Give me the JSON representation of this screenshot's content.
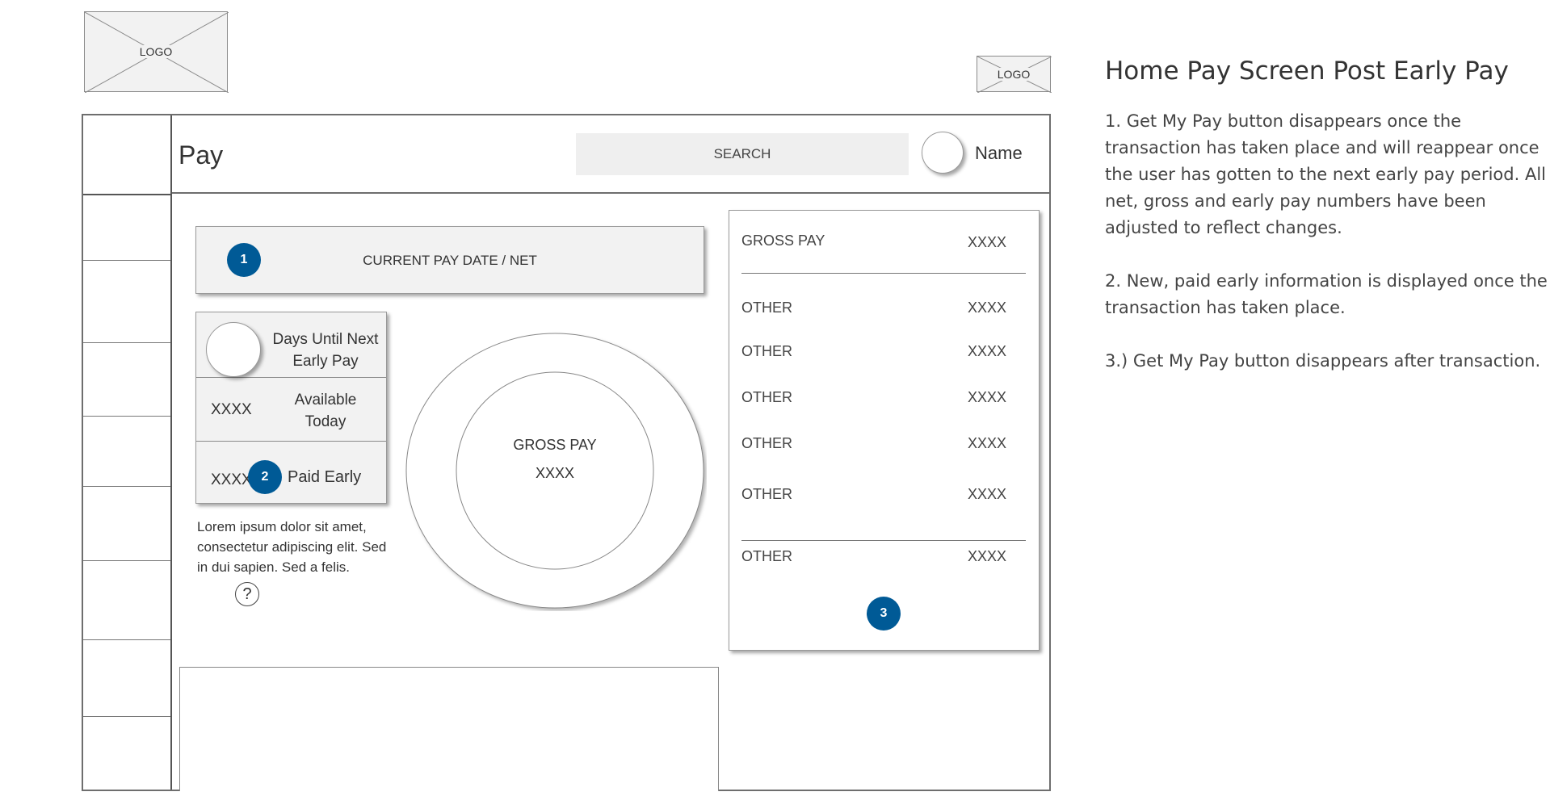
{
  "header_logo_left": "LOGO",
  "header_logo_right": "LOGO",
  "app": {
    "title": "Pay",
    "search_label": "SEARCH",
    "user_name": "Name"
  },
  "sidebar": {
    "item_count": 8
  },
  "current_pay": {
    "badge": "1",
    "label": "CURRENT PAY DATE / NET"
  },
  "early_pay": {
    "days_until_label": "Days Until Next Early Pay",
    "available_value": "XXXX",
    "available_label": "Available Today",
    "paid_value": "XXXX",
    "paid_badge": "2",
    "paid_label": "Paid Early",
    "lorem": "Lorem ipsum dolor sit amet, consectetur adipiscing elit. Sed in dui sapien. Sed a felis.",
    "help_icon": "?"
  },
  "donut": {
    "label": "GROSS PAY",
    "value": "XXXX"
  },
  "breakdown": {
    "gross_label": "GROSS PAY",
    "gross_value": "XXXX",
    "rows": [
      {
        "label": "OTHER",
        "value": "XXXX"
      },
      {
        "label": "OTHER",
        "value": "XXXX"
      },
      {
        "label": "OTHER",
        "value": "XXXX"
      },
      {
        "label": "OTHER",
        "value": "XXXX"
      },
      {
        "label": "OTHER",
        "value": "XXXX"
      }
    ],
    "total_label": "OTHER",
    "total_value": "XXXX",
    "badge": "3"
  },
  "notes": {
    "title": "Home Pay Screen Post Early Pay",
    "items": [
      "1. Get My Pay button disappears once the transaction has taken place and will reappear once the user has gotten to the next early pay period. All net, gross and early pay numbers have been adjusted to reflect changes.",
      "2. New, paid early information is displayed once the transaction has taken place.",
      "3.) Get My Pay button disappears after transaction."
    ]
  },
  "colors": {
    "badge": "#005a96",
    "placeholder_fill": "#f2f2f2",
    "border": "#777777"
  }
}
